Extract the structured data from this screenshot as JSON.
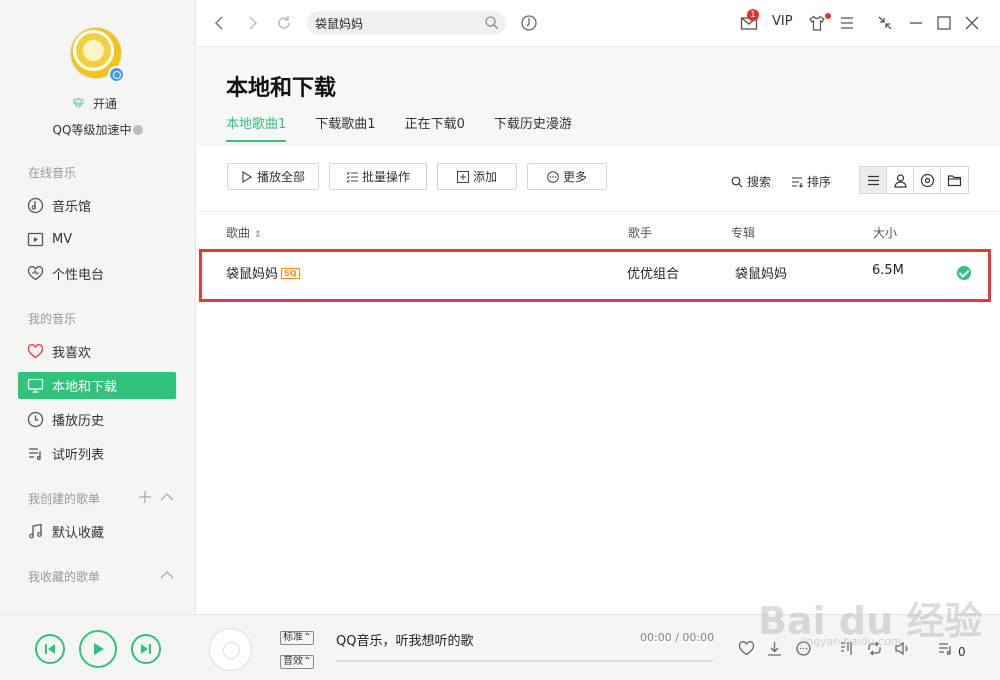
{
  "sidebar": {
    "vip_label": "开通",
    "level_label": "QQ等级加速中",
    "sections": {
      "online": "在线音乐",
      "mine": "我的音乐",
      "created": "我创建的歌单",
      "collected": "我收藏的歌单"
    },
    "items": [
      {
        "label": "音乐馆",
        "icon": "music-hall-icon"
      },
      {
        "label": "MV",
        "icon": "mv-icon"
      },
      {
        "label": "个性电台",
        "icon": "radio-icon"
      },
      {
        "label": "我喜欢",
        "icon": "heart-icon"
      },
      {
        "label": "本地和下载",
        "icon": "monitor-icon"
      },
      {
        "label": "播放历史",
        "icon": "clock-icon"
      },
      {
        "label": "试听列表",
        "icon": "playlist-icon"
      },
      {
        "label": "默认收藏",
        "icon": "note-icon"
      }
    ]
  },
  "topbar": {
    "search_value": "袋鼠妈妈",
    "mail_count": "1",
    "vip": "VIP"
  },
  "header": {
    "title": "本地和下载",
    "tabs": [
      "本地歌曲1",
      "下载歌曲1",
      "正在下载0",
      "下载历史漫游"
    ]
  },
  "toolbar": {
    "play_all": "播放全部",
    "batch": "批量操作",
    "add": "添加",
    "more": "更多",
    "search": "搜索",
    "sort": "排序"
  },
  "table": {
    "headers": {
      "song": "歌曲",
      "artist": "歌手",
      "album": "专辑",
      "size": "大小"
    },
    "rows": [
      {
        "song": "袋鼠妈妈",
        "quality": "SQ",
        "artist": "优优组合",
        "album": "袋鼠妈妈",
        "size": "6.5M"
      }
    ]
  },
  "player": {
    "quality_std": "标准",
    "quality_fx": "音效",
    "now_playing": "QQ音乐，听我想听的歌",
    "time": "00:00 / 00:00",
    "queue_count": "0"
  },
  "watermark": {
    "text": "Bai du 经验",
    "sub": "jingyan.baidu.com"
  },
  "colors": {
    "accent": "#31c27c",
    "highlight": "#e8383d",
    "badge": "#e0322b"
  }
}
